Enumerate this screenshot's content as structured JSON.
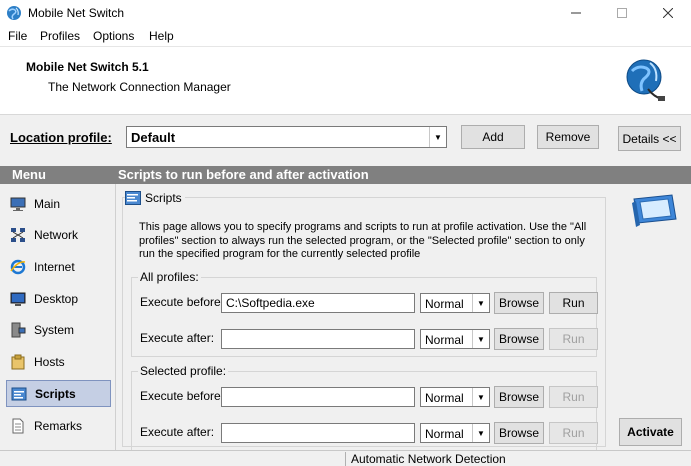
{
  "window": {
    "title": "Mobile Net Switch"
  },
  "menu": {
    "file": "File",
    "profiles": "Profiles",
    "options": "Options",
    "help": "Help"
  },
  "header": {
    "title": "Mobile Net Switch 5.1",
    "subtitle": "The Network Connection Manager",
    "logo_icon": "globe-network-icon"
  },
  "toolbar": {
    "location_label": "Location profile:",
    "location_value": "Default",
    "add_label": "Add",
    "remove_label": "Remove",
    "details_label": "Details <<"
  },
  "section": {
    "menu_title": "Menu",
    "page_title": "Scripts to run before and after activation"
  },
  "sidebar": {
    "items": [
      {
        "label": "Main",
        "icon": "monitor-icon"
      },
      {
        "label": "Network",
        "icon": "network-icon"
      },
      {
        "label": "Internet",
        "icon": "internet-explorer-icon"
      },
      {
        "label": "Desktop",
        "icon": "desktop-icon"
      },
      {
        "label": "System",
        "icon": "system-icon"
      },
      {
        "label": "Hosts",
        "icon": "hosts-icon"
      },
      {
        "label": "Scripts",
        "icon": "scripts-icon"
      },
      {
        "label": "Remarks",
        "icon": "remarks-icon"
      }
    ],
    "active": "Scripts"
  },
  "scripts": {
    "group_title": "Scripts",
    "description": "This page allows you to specify programs and scripts to run at profile activation. Use the \"All profiles\" section to always run the selected program, or the \"Selected profile\" section to only run the specified program for the currently selected profile",
    "all_profiles": {
      "title": "All profiles:",
      "before_label": "Execute before:",
      "before_value": "C:\\Softpedia.exe",
      "before_mode": "Normal",
      "after_label": "Execute after:",
      "after_value": "",
      "after_mode": "Normal"
    },
    "selected_profile": {
      "title": "Selected profile:",
      "before_label": "Execute before:",
      "before_value": "",
      "before_mode": "Normal",
      "after_label": "Execute after:",
      "after_value": "",
      "after_mode": "Normal"
    },
    "browse_label": "Browse",
    "run_label": "Run"
  },
  "activate_label": "Activate",
  "status": {
    "text": "Automatic Network Detection"
  },
  "colors": {
    "section_bar": "#808080",
    "active_nav": "#c5cfe4",
    "window_bg": "#f0f0f0"
  }
}
